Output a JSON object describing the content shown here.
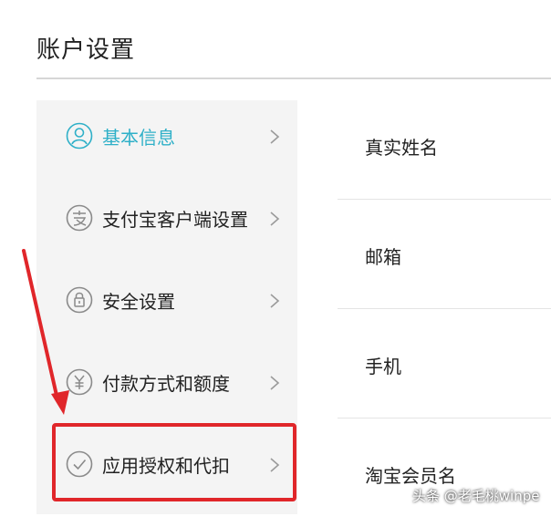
{
  "page": {
    "title": "账户设置"
  },
  "sidebar": {
    "items": [
      {
        "label": "基本信息",
        "icon": "user-icon",
        "active": true
      },
      {
        "label": "支付宝客户端设置",
        "icon": "alipay-icon",
        "active": false
      },
      {
        "label": "安全设置",
        "icon": "lock-icon",
        "active": false
      },
      {
        "label": "付款方式和额度",
        "icon": "yuan-icon",
        "active": false
      },
      {
        "label": "应用授权和代扣",
        "icon": "check-icon",
        "active": false
      }
    ]
  },
  "content": {
    "rows": [
      {
        "label": "真实姓名"
      },
      {
        "label": "邮箱"
      },
      {
        "label": "手机"
      },
      {
        "label": "淘宝会员名"
      }
    ]
  },
  "annotation": {
    "highlight_color": "#e0262a"
  },
  "watermark": {
    "text": "头条 @老毛桃winpe"
  },
  "colors": {
    "accent": "#2fb0c8",
    "sidebar_bg": "#f4f4f4",
    "icon_gray": "#8a8a8a"
  }
}
